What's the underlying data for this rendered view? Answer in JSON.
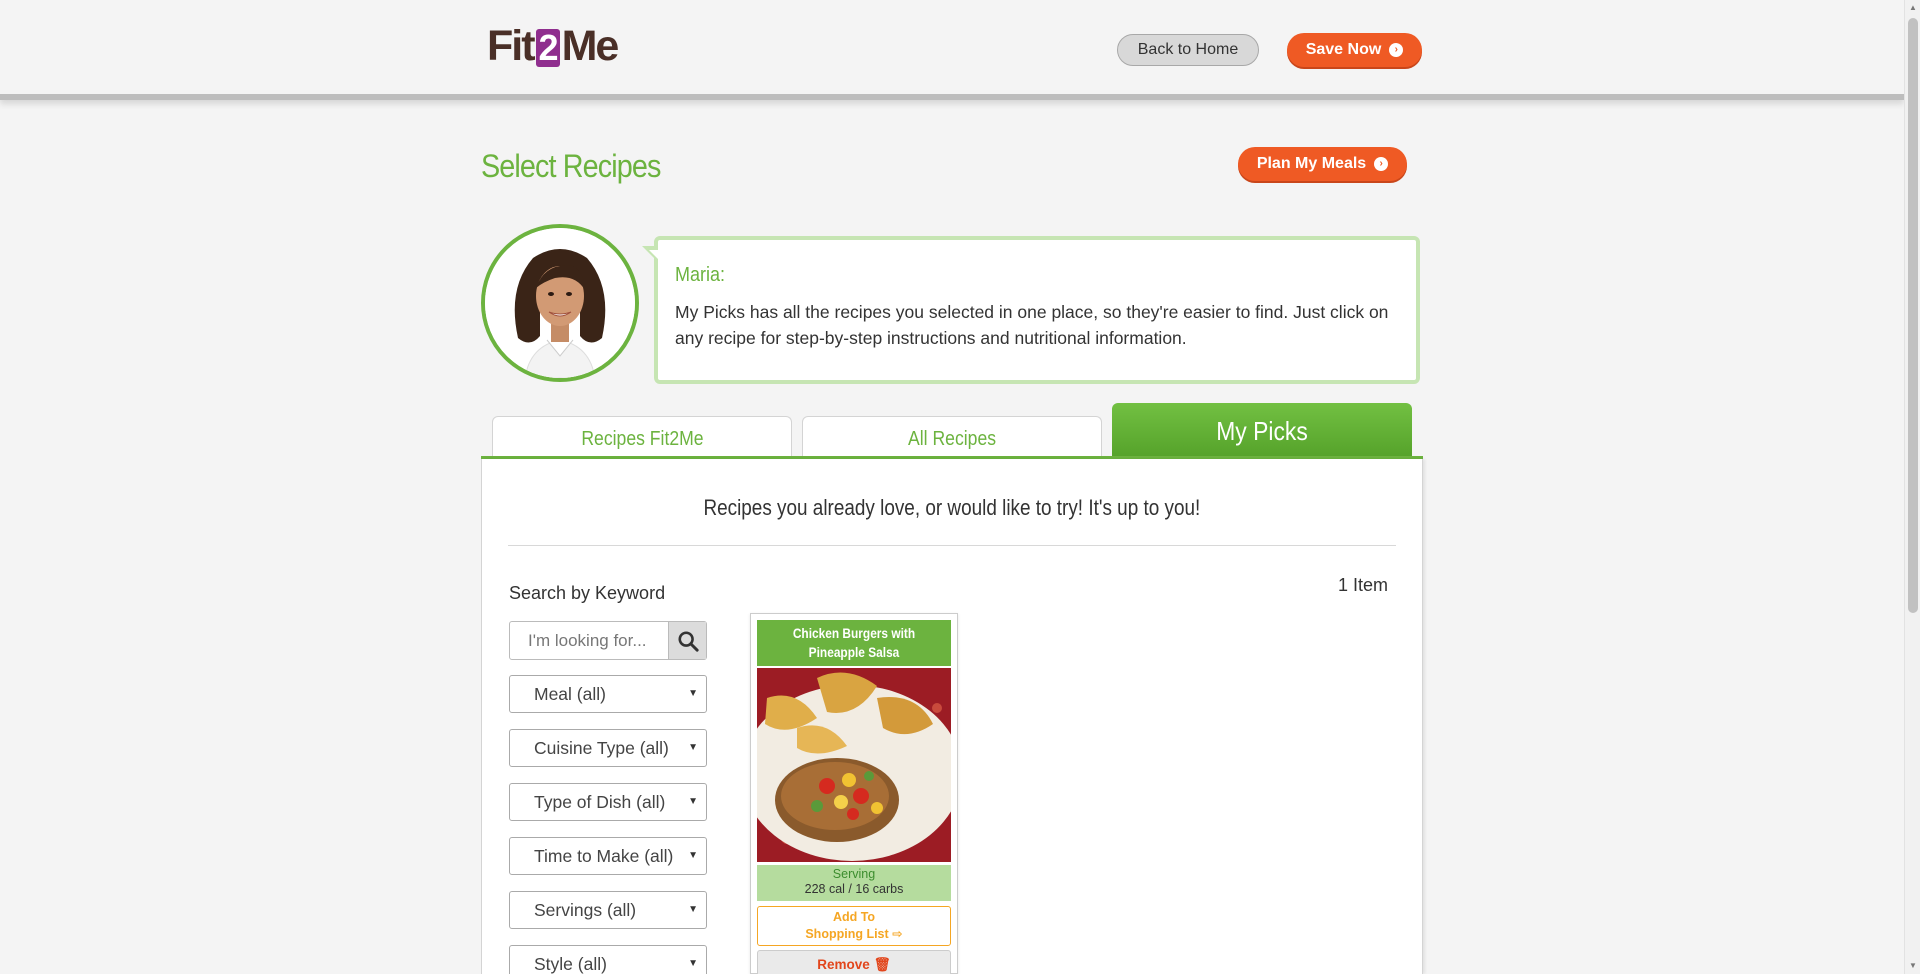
{
  "header": {
    "logo_left": "Fit",
    "logo_mid": "2",
    "logo_right": "Me",
    "back_label": "Back to Home",
    "save_label": "Save Now"
  },
  "page": {
    "title": "Select Recipes",
    "plan_label": "Plan My Meals"
  },
  "coach": {
    "name": "Maria:",
    "message": "My Picks has all the recipes you selected in one place, so they're easier to find. Just click on any recipe for step-by-step instructions and nutritional information."
  },
  "tabs": [
    {
      "label": "Recipes Fit2Me",
      "active": false
    },
    {
      "label": "All Recipes",
      "active": false
    },
    {
      "label": "My Picks",
      "active": true
    }
  ],
  "panel": {
    "subtitle": "Recipes you already love, or would like to try! It's up to you!",
    "item_count": "1 Item"
  },
  "filters": {
    "search_label": "Search by Keyword",
    "search_placeholder": "I'm looking for...",
    "selects": [
      {
        "value": "Meal (all)"
      },
      {
        "value": "Cuisine Type (all)"
      },
      {
        "value": "Type of Dish (all)"
      },
      {
        "value": "Time to Make (all)"
      },
      {
        "value": "Servings (all)"
      },
      {
        "value": "Style (all)"
      }
    ]
  },
  "recipes": [
    {
      "title": "Chicken Burgers with Pineapple Salsa",
      "serving_label": "Serving",
      "nutrition": "228 cal / 16 carbs",
      "shop_line1": "Add To",
      "shop_line2": "Shopping List",
      "remove_label": "Remove"
    }
  ],
  "colors": {
    "brand_green": "#6cb33f",
    "accent_orange": "#ef5a24",
    "logo_brown": "#4a2f27",
    "logo_purple": "#8f2e8e"
  }
}
